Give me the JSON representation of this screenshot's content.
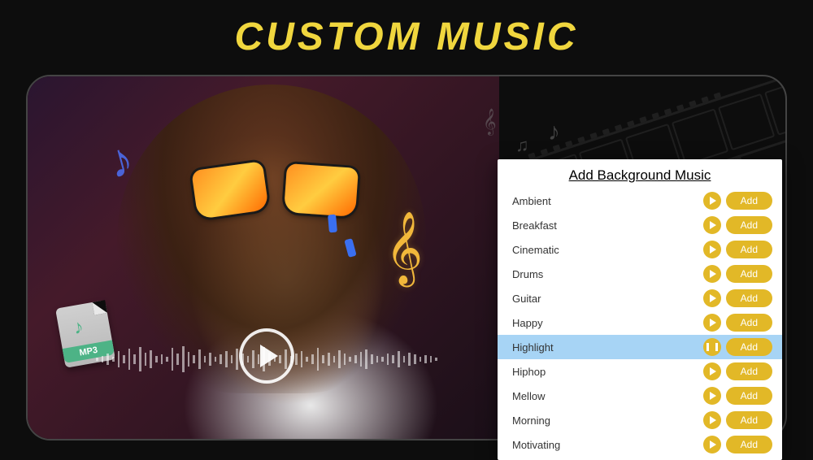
{
  "title": "CUSTOM MUSIC",
  "mp3_badge": "MP3",
  "panel": {
    "title": "Add Background Music",
    "add_label": "Add",
    "tracks": [
      {
        "name": "Ambient",
        "state": "play"
      },
      {
        "name": "Breakfast",
        "state": "play"
      },
      {
        "name": "Cinematic",
        "state": "play"
      },
      {
        "name": "Drums",
        "state": "play"
      },
      {
        "name": "Guitar",
        "state": "play"
      },
      {
        "name": "Happy",
        "state": "play"
      },
      {
        "name": "Highlight",
        "state": "pause",
        "selected": true
      },
      {
        "name": "Hiphop",
        "state": "play"
      },
      {
        "name": "Mellow",
        "state": "play"
      },
      {
        "name": "Morning",
        "state": "play"
      },
      {
        "name": "Motivating",
        "state": "play"
      }
    ]
  },
  "colors": {
    "accent": "#e2b827",
    "title": "#f0d63e",
    "selected_row": "#a7d4f5"
  }
}
